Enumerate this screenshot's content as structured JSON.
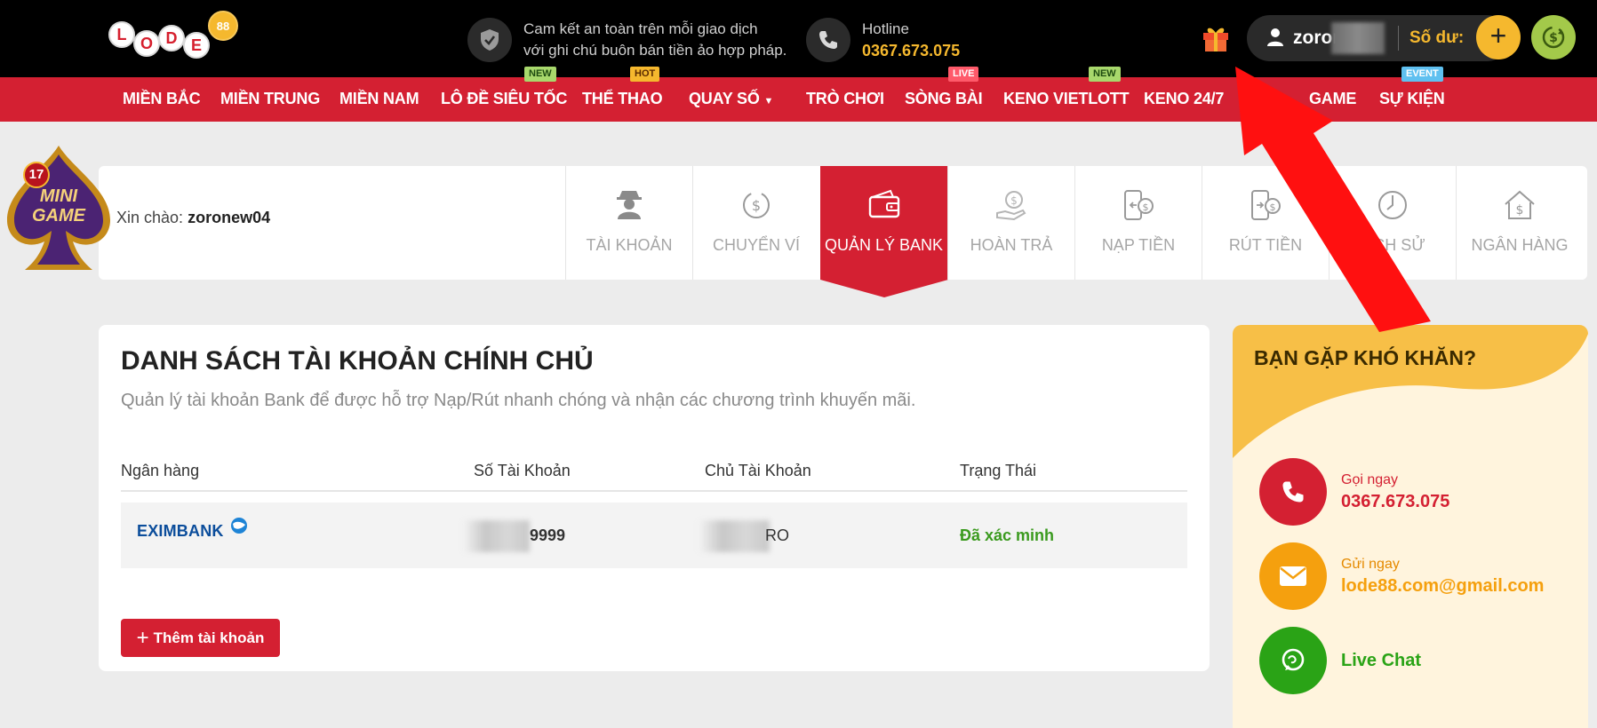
{
  "header": {
    "logo_letters": [
      "L",
      "O",
      "D",
      "E"
    ],
    "logo_ball": "88",
    "safety_line1": "Cam kết an toàn trên mỗi giao dịch",
    "safety_line2": "với ghi chú buôn bán tiền ảo hợp pháp.",
    "hotline_label": "Hotline",
    "hotline_number": "0367.673.075",
    "username": "zoron",
    "balance_label": "Số dư:",
    "plus_label": "+"
  },
  "nav": {
    "items": [
      "MIỀN BẮC",
      "MIỀN TRUNG",
      "MIỀN NAM",
      "LÔ ĐỀ SIÊU TỐC",
      "THỂ THAO",
      "QUAY SỐ",
      "TRÒ CHƠI",
      "SÒNG BÀI",
      "KENO VIETLOTT",
      "KENO 24/7",
      "GAME",
      "SỰ KIỆN"
    ],
    "badges": [
      "NEW",
      "HOT",
      "LIVE",
      "NEW",
      "EVENT"
    ]
  },
  "minigame": {
    "count": "17",
    "line1": "MINI",
    "line2": "GAME"
  },
  "profile": {
    "greeting": "Xin chào:",
    "username": "zoronew04",
    "tabs": [
      "TÀI KHOẢN",
      "CHUYỂN VÍ",
      "QUẢN LÝ BANK",
      "HOÀN TRẢ",
      "NẠP TIỀN",
      "RÚT TIỀN",
      "LỊCH SỬ",
      "NGÂN HÀNG"
    ]
  },
  "bank_list": {
    "title": "DANH SÁCH TÀI KHOẢN CHÍNH CHỦ",
    "description": "Quản lý tài khoản Bank để được hỗ trợ Nạp/Rút nhanh chóng và nhận các chương trình khuyến mãi.",
    "columns": [
      "Ngân hàng",
      "Số Tài Khoản",
      "Chủ Tài Khoản",
      "Trạng Thái"
    ],
    "rows": [
      {
        "bank": "EXIMBANK",
        "account": "9999",
        "owner": "RO",
        "status": "Đã xác minh"
      }
    ],
    "add_button": "Thêm tài khoản"
  },
  "support": {
    "title": "BẠN GẶP KHÓ KHĂN?",
    "call_label": "Gọi ngay",
    "call_value": "0367.673.075",
    "mail_label": "Gửi ngay",
    "mail_value": "lode88.com@gmail.com",
    "chat_label": "Live Chat"
  },
  "colors": {
    "brand_red": "#d42032",
    "gold": "#f5b82e",
    "green": "#3a9a1e",
    "annotation": "#ff1010"
  }
}
